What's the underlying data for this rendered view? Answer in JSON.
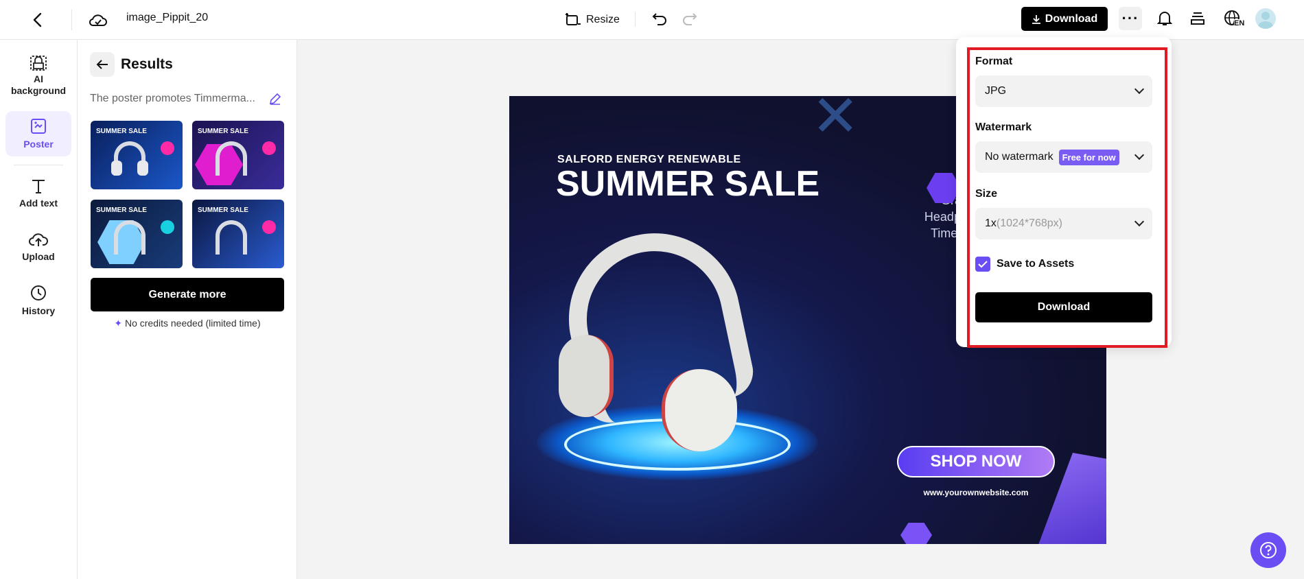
{
  "topbar": {
    "file_name": "image_Pippit_20",
    "resize_label": "Resize",
    "download_label": "Download",
    "lang_badge": "EN"
  },
  "sidebar": {
    "items": [
      {
        "label": "AI background",
        "icon": "ai-background-icon"
      },
      {
        "label": "Poster",
        "icon": "poster-icon",
        "active": true
      },
      {
        "label": "Add text",
        "icon": "text-icon"
      },
      {
        "label": "Upload",
        "icon": "upload-icon"
      },
      {
        "label": "History",
        "icon": "history-icon"
      }
    ]
  },
  "panel": {
    "title": "Results",
    "prompt": "The poster promotes Timmerma...",
    "thumbs": [
      {
        "title": "SUMMER SALE"
      },
      {
        "title": "SUMMER SALE"
      },
      {
        "title": "SUMMER SALE"
      },
      {
        "title": "SUMMER SALE"
      }
    ],
    "generate_label": "Generate more",
    "credits_note": "No credits needed (limited time)"
  },
  "poster": {
    "kicker": "SALFORD ENERGY RENEWABLE",
    "title": "SUMMER SALE",
    "side_text": [
      "Grab it n",
      "Headphone",
      "Time Offer"
    ],
    "cta": "SHOP NOW",
    "website": "www.yourownwebsite.com"
  },
  "download_popup": {
    "format_label": "Format",
    "format_value": "JPG",
    "watermark_label": "Watermark",
    "watermark_value": "No watermark",
    "watermark_tag": "Free for now",
    "size_label": "Size",
    "size_value": "1x",
    "size_hint": "(1024*768px)",
    "save_assets_label": "Save to Assets",
    "save_assets_checked": true,
    "download_button": "Download"
  },
  "colors": {
    "accent": "#6b4ef3",
    "highlight": "#e01b24",
    "poster_bg": "#14184a",
    "cta": "#7b3cf0"
  }
}
